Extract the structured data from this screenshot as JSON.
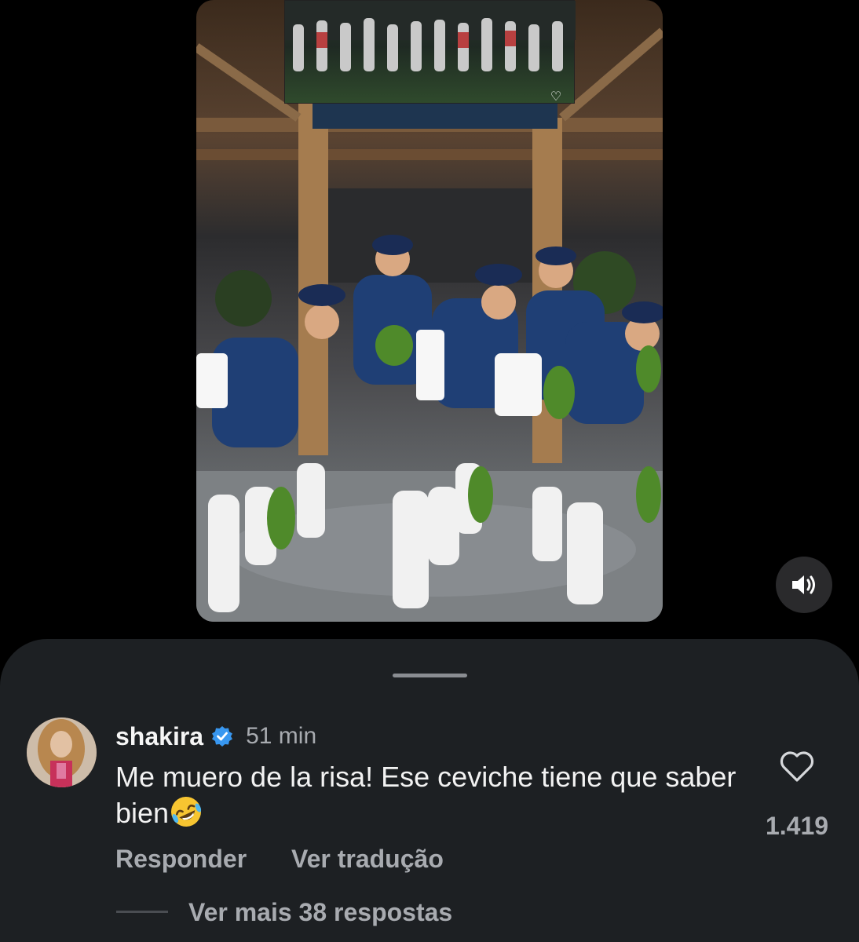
{
  "comment": {
    "username": "shakira",
    "timestamp": "51 min",
    "text": "Me muero de la risa! Ese ceviche tiene que saber bien",
    "emoji": "rolling-on-floor-laughing",
    "likes": "1.419"
  },
  "actions": {
    "reply": "Responder",
    "translate": "Ver tradução",
    "view_replies": "Ver mais 38 respostas"
  },
  "icons": {
    "verified": "verified-badge-icon",
    "like": "heart-outline-icon",
    "sound": "speaker-icon"
  },
  "colors": {
    "verified": "#3897f0",
    "sheet_bg": "#1d2023",
    "muted_text": "#a8abb0"
  }
}
